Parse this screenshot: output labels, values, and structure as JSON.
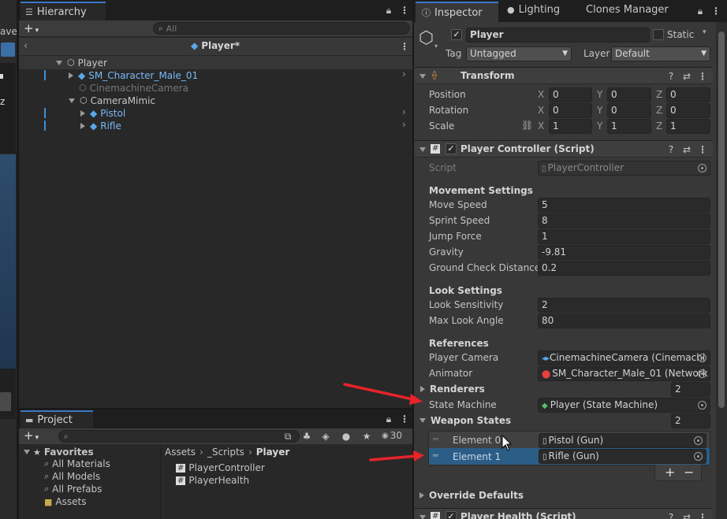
{
  "left_edge": {
    "partial_text_1": "ave",
    "partial_text_2": "z"
  },
  "hierarchy": {
    "tab_label": "Hierarchy",
    "search_placeholder": "All",
    "scene_title": "Player*",
    "items": [
      {
        "label": "Player",
        "color": "#c4c4c4"
      },
      {
        "label": "SM_Character_Male_01",
        "color": "#7ab8f5"
      },
      {
        "label": "CinemachineCamera",
        "color": "#777777"
      },
      {
        "label": "CameraMimic",
        "color": "#c4c4c4"
      },
      {
        "label": "Pistol",
        "color": "#7ab8f5"
      },
      {
        "label": "Rifle",
        "color": "#7ab8f5"
      }
    ]
  },
  "project": {
    "tab_label": "Project",
    "visible_count": "30",
    "favorites": {
      "title": "Favorites",
      "items": [
        "All Materials",
        "All Models",
        "All Prefabs"
      ]
    },
    "assets_label": "Assets",
    "breadcrumb": [
      "Assets",
      "_Scripts",
      "Player"
    ],
    "files": [
      "PlayerController",
      "PlayerHealth"
    ]
  },
  "inspector": {
    "tabs": [
      "Inspector",
      "Lighting",
      "Clones Manager"
    ],
    "object_name": "Player",
    "static_label": "Static",
    "tag_label": "Tag",
    "tag_value": "Untagged",
    "layer_label": "Layer",
    "layer_value": "Default",
    "transform": {
      "title": "Transform",
      "rows": [
        {
          "label": "Position",
          "x": "0",
          "y": "0",
          "z": "0"
        },
        {
          "label": "Rotation",
          "x": "0",
          "y": "0",
          "z": "0"
        },
        {
          "label": "Scale",
          "x": "1",
          "y": "1",
          "z": "1"
        }
      ],
      "axis": [
        "X",
        "Y",
        "Z"
      ]
    },
    "player_controller": {
      "title": "Player Controller (Script)",
      "script_label": "Script",
      "script_value": "PlayerController",
      "movement_header": "Movement Settings",
      "movement": [
        {
          "label": "Move Speed",
          "value": "5"
        },
        {
          "label": "Sprint Speed",
          "value": "8"
        },
        {
          "label": "Jump Force",
          "value": "1"
        },
        {
          "label": "Gravity",
          "value": "-9.81"
        },
        {
          "label": "Ground Check Distance",
          "value": "0.2"
        }
      ],
      "look_header": "Look Settings",
      "look": [
        {
          "label": "Look Sensitivity",
          "value": "2"
        },
        {
          "label": "Max Look Angle",
          "value": "80"
        }
      ],
      "references_header": "References",
      "player_camera_label": "Player Camera",
      "player_camera_value": "CinemachineCamera (Cinemachi",
      "animator_label": "Animator",
      "animator_value": "SM_Character_Male_01 (Network",
      "renderers_label": "Renderers",
      "renderers_count": "2",
      "state_machine_label": "State Machine",
      "state_machine_value": "Player (State Machine)",
      "weapon_states_label": "Weapon States",
      "weapon_states_count": "2",
      "elements": [
        {
          "label": "Element 0",
          "value": "Pistol (Gun)"
        },
        {
          "label": "Element 1",
          "value": "Rifle (Gun)"
        }
      ],
      "add_btn": "+",
      "remove_btn": "−",
      "override_defaults": "Override Defaults"
    },
    "player_health_title": "Player Health (Script)"
  },
  "colors": {
    "accent_blue": "#7ab8f5",
    "selection": "#2c5d87",
    "arrow_red": "#e8232a"
  }
}
